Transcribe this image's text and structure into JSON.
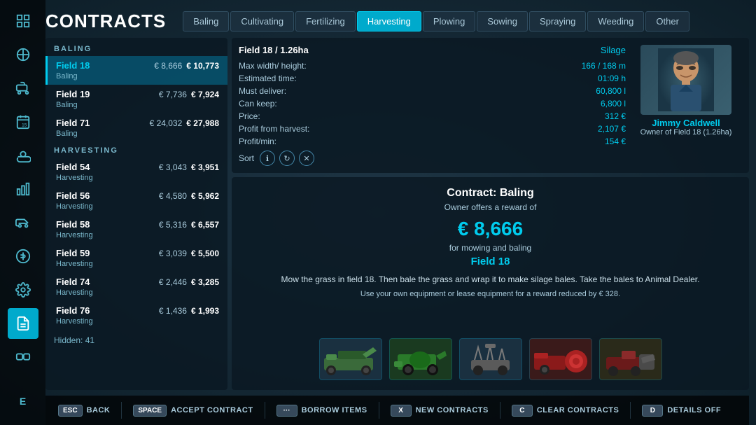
{
  "title": "CONTRACTS",
  "tabs": [
    {
      "label": "Baling",
      "active": false
    },
    {
      "label": "Cultivating",
      "active": false
    },
    {
      "label": "Fertilizing",
      "active": false
    },
    {
      "label": "Harvesting",
      "active": true
    },
    {
      "label": "Plowing",
      "active": false
    },
    {
      "label": "Sowing",
      "active": false
    },
    {
      "label": "Spraying",
      "active": false
    },
    {
      "label": "Weeding",
      "active": false
    },
    {
      "label": "Other",
      "active": false
    }
  ],
  "sections": [
    {
      "name": "BALING",
      "items": [
        {
          "field": "Field 18",
          "type": "Baling",
          "priceMin": "€ 8,666",
          "priceMax": "€ 10,773",
          "selected": true
        },
        {
          "field": "Field 19",
          "type": "Baling",
          "priceMin": "€ 7,736",
          "priceMax": "€ 7,924",
          "selected": false
        },
        {
          "field": "Field 71",
          "type": "Baling",
          "priceMin": "€ 24,032",
          "priceMax": "€ 27,988",
          "selected": false
        }
      ]
    },
    {
      "name": "HARVESTING",
      "items": [
        {
          "field": "Field 54",
          "type": "Harvesting",
          "priceMin": "€ 3,043",
          "priceMax": "€ 3,951",
          "selected": false
        },
        {
          "field": "Field 56",
          "type": "Harvesting",
          "priceMin": "€ 4,580",
          "priceMax": "€ 5,962",
          "selected": false
        },
        {
          "field": "Field 58",
          "type": "Harvesting",
          "priceMin": "€ 5,316",
          "priceMax": "€ 6,557",
          "selected": false
        },
        {
          "field": "Field 59",
          "type": "Harvesting",
          "priceMin": "€ 3,039",
          "priceMax": "€ 5,500",
          "selected": false
        },
        {
          "field": "Field 74",
          "type": "Harvesting",
          "priceMin": "€ 2,446",
          "priceMax": "€ 3,285",
          "selected": false
        },
        {
          "field": "Field 76",
          "type": "Harvesting",
          "priceMin": "€ 1,436",
          "priceMax": "€ 1,993",
          "selected": false
        }
      ]
    }
  ],
  "hidden_count": "Hidden: 41",
  "selected_contract": {
    "field_id": "Field 18 / 1.26ha",
    "crop_type": "Silage",
    "max_width_height": "166 / 168 m",
    "estimated_time": "01:09 h",
    "must_deliver": "60,800 l",
    "can_keep": "6,800 l",
    "price": "312 €",
    "profit_from_harvest": "2,107 €",
    "profit_min": "154 €",
    "owner_name": "Jimmy Caldwell",
    "owner_desc": "Owner of Field 18 (1.26ha)",
    "contract_heading": "Contract: Baling",
    "contract_subheading": "Owner offers a reward of",
    "reward_amount": "€ 8,666",
    "reward_for": "for mowing and baling",
    "field_name": "Field 18",
    "description": "Mow the grass in field 18. Then bale the grass and wrap it to make silage bales. Take the bales to Animal Dealer.",
    "lease_info": "Use your own equipment or lease equipment for a reward reduced by € 328."
  },
  "toolbar": [
    {
      "key": "ESC",
      "label": "BACK"
    },
    {
      "key": "SPACE",
      "label": "ACCEPT CONTRACT"
    },
    {
      "key": "···",
      "label": "BORROW ITEMS"
    },
    {
      "key": "X",
      "label": "NEW CONTRACTS"
    },
    {
      "key": "C",
      "label": "CLEAR CONTRACTS"
    },
    {
      "key": "D",
      "label": "DETAILS OFF"
    }
  ],
  "sidebar_icons": [
    "🗺",
    "🌱",
    "🚜",
    "📅",
    "🌤",
    "📊",
    "🚜",
    "💰",
    "🔧",
    "📋",
    "🔗",
    "E"
  ],
  "equipment_icons": [
    "🔧",
    "🌿",
    "⚙️",
    "🔴",
    "🛠"
  ]
}
